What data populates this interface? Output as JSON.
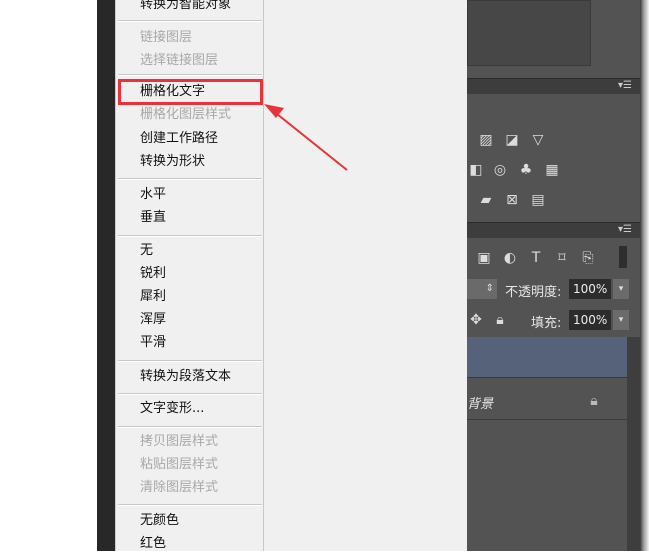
{
  "context_menu": {
    "items": [
      {
        "label": "转换为智能对象",
        "disabled": false
      },
      {
        "sep": true
      },
      {
        "label": "链接图层",
        "disabled": true
      },
      {
        "label": "选择链接图层",
        "disabled": true
      },
      {
        "sep": true
      },
      {
        "label": "栅格化文字",
        "disabled": false,
        "highlighted": true
      },
      {
        "label": "栅格化图层样式",
        "disabled": true
      },
      {
        "label": "创建工作路径",
        "disabled": false
      },
      {
        "label": "转换为形状",
        "disabled": false
      },
      {
        "sep": true
      },
      {
        "label": "水平",
        "disabled": false
      },
      {
        "label": "垂直",
        "disabled": false
      },
      {
        "sep": true
      },
      {
        "label": "无",
        "disabled": false
      },
      {
        "label": "锐利",
        "disabled": false
      },
      {
        "label": "犀利",
        "disabled": false
      },
      {
        "label": "浑厚",
        "disabled": false
      },
      {
        "label": "平滑",
        "disabled": false
      },
      {
        "sep": true
      },
      {
        "label": "转换为段落文本",
        "disabled": false
      },
      {
        "sep": true
      },
      {
        "label": "文字变形...",
        "disabled": false
      },
      {
        "sep": true
      },
      {
        "label": "拷贝图层样式",
        "disabled": true
      },
      {
        "label": "粘贴图层样式",
        "disabled": true
      },
      {
        "label": "清除图层样式",
        "disabled": true
      },
      {
        "sep": true
      },
      {
        "label": "无颜色",
        "disabled": false
      },
      {
        "label": "红色",
        "disabled": false
      }
    ]
  },
  "annotation": {
    "color": "#e8333a"
  },
  "layers_panel": {
    "opacity_label": "不透明度:",
    "opacity_value": "100%",
    "fill_label": "填充:",
    "fill_value": "100%",
    "layers": [
      {
        "name": "",
        "selected": true,
        "color": "#56627a"
      },
      {
        "name": "背景",
        "locked": true
      }
    ]
  }
}
